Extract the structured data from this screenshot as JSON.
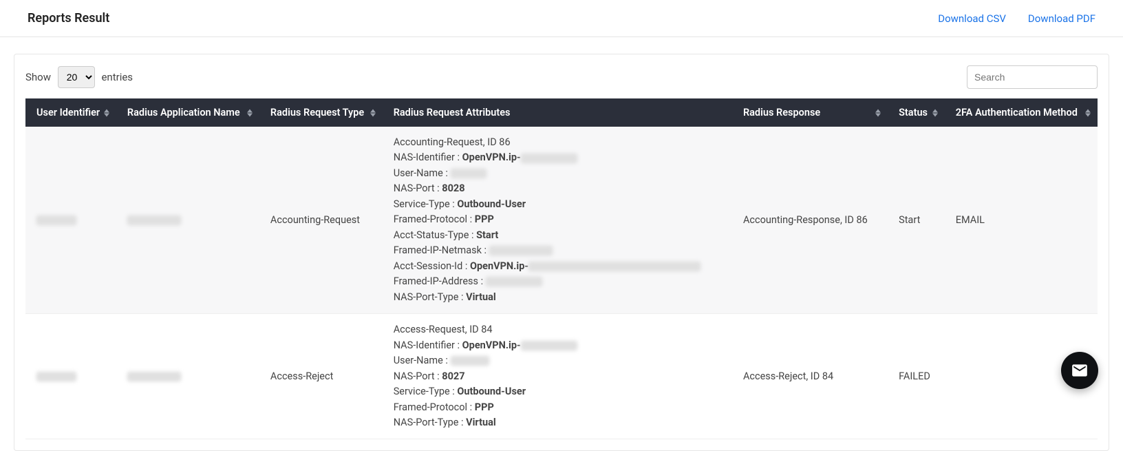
{
  "header": {
    "title": "Reports Result",
    "download_csv": "Download CSV",
    "download_pdf": "Download PDF"
  },
  "controls": {
    "show_label": "Show",
    "entries_label": "entries",
    "page_size": "20",
    "search_placeholder": "Search"
  },
  "columns": [
    "User Identifier",
    "Radius Application Name",
    "Radius Request Type",
    "Radius Request Attributes",
    "Radius Response",
    "Status",
    "2FA Authentication Method"
  ],
  "rows": [
    {
      "request_type": "Accounting-Request",
      "attrs": [
        {
          "label": "Accounting-Request, ID 86"
        },
        {
          "label": "NAS-Identifier : ",
          "bold": "OpenVPN.ip-",
          "mask_w": 82
        },
        {
          "label": "User-Name : ",
          "mask_w": 52
        },
        {
          "label": "NAS-Port : ",
          "bold": "8028"
        },
        {
          "label": "Service-Type : ",
          "bold": "Outbound-User"
        },
        {
          "label": "Framed-Protocol : ",
          "bold": "PPP"
        },
        {
          "label": "Acct-Status-Type : ",
          "bold": "Start"
        },
        {
          "label": "Framed-IP-Netmask : ",
          "mask_w": 92
        },
        {
          "label": "Acct-Session-Id : ",
          "bold": "OpenVPN.ip-",
          "mask_w": 250
        },
        {
          "label": "Framed-IP-Address : ",
          "mask_w": 82
        },
        {
          "label": "NAS-Port-Type : ",
          "bold": "Virtual"
        }
      ],
      "response": "Accounting-Response, ID 86",
      "status": "Start",
      "method": "EMAIL"
    },
    {
      "request_type": "Access-Reject",
      "attrs": [
        {
          "label": "Access-Request, ID 84"
        },
        {
          "label": "NAS-Identifier : ",
          "bold": "OpenVPN.ip-",
          "mask_w": 82
        },
        {
          "label": "User-Name : ",
          "mask_w": 56
        },
        {
          "label": "NAS-Port : ",
          "bold": "8027"
        },
        {
          "label": "Service-Type : ",
          "bold": "Outbound-User"
        },
        {
          "label": "Framed-Protocol : ",
          "bold": "PPP"
        },
        {
          "label": "NAS-Port-Type : ",
          "bold": "Virtual"
        }
      ],
      "response": "Access-Reject, ID 84",
      "status": "FAILED",
      "method": ""
    }
  ]
}
